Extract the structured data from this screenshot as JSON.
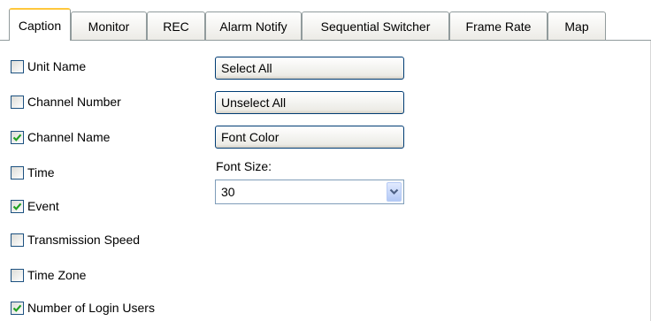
{
  "tabs": [
    {
      "label": "Caption",
      "active": true
    },
    {
      "label": "Monitor",
      "active": false
    },
    {
      "label": "REC",
      "active": false
    },
    {
      "label": "Alarm Notify",
      "active": false
    },
    {
      "label": "Sequential Switcher",
      "active": false
    },
    {
      "label": "Frame Rate",
      "active": false
    },
    {
      "label": "Map",
      "active": false
    }
  ],
  "options": [
    {
      "label": "Unit Name",
      "checked": false
    },
    {
      "label": "Channel Number",
      "checked": false
    },
    {
      "label": "Channel Name",
      "checked": true
    },
    {
      "label": "Time",
      "checked": false
    },
    {
      "label": "Event",
      "checked": true
    },
    {
      "label": "Transmission Speed",
      "checked": false
    },
    {
      "label": "Time Zone",
      "checked": false
    },
    {
      "label": "Number of Login Users",
      "checked": true
    }
  ],
  "buttons": {
    "select_all": "Select All",
    "unselect_all": "Unselect All",
    "font_color": "Font Color"
  },
  "font_size": {
    "label": "Font Size:",
    "value": "30"
  },
  "icons": {
    "checkmark": "checkmark-icon",
    "dropdown": "chevron-down-icon"
  },
  "colors": {
    "active_tab_accent": "#ffc83c",
    "checkmark": "#21a121",
    "control_border": "#003c74"
  }
}
